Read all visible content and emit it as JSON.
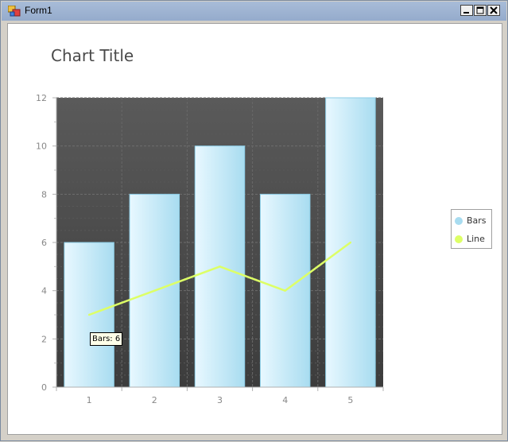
{
  "window": {
    "title": "Form1"
  },
  "colors": {
    "bar_light": "#e8f8ff",
    "bar_dark": "#a8dcf0",
    "line": "#ddff66",
    "plot_bg": "#4c4c4c"
  },
  "icons": {
    "app": "form-icon",
    "minimize": "minimize-icon",
    "maximize": "maximize-icon",
    "close": "close-icon"
  },
  "chart_data": {
    "type": "bar",
    "title": "Chart Title",
    "categories": [
      "1",
      "2",
      "3",
      "4",
      "5"
    ],
    "series": [
      {
        "name": "Bars",
        "type": "bar",
        "values": [
          6,
          8,
          10,
          8,
          12
        ]
      },
      {
        "name": "Line",
        "type": "line",
        "values": [
          3,
          4,
          5,
          4,
          6
        ]
      }
    ],
    "ylim": [
      0,
      12
    ],
    "yticks": [
      0,
      2,
      4,
      6,
      8,
      10,
      12
    ],
    "grid": true,
    "legend": "right",
    "tooltip": "Bars: 6"
  }
}
